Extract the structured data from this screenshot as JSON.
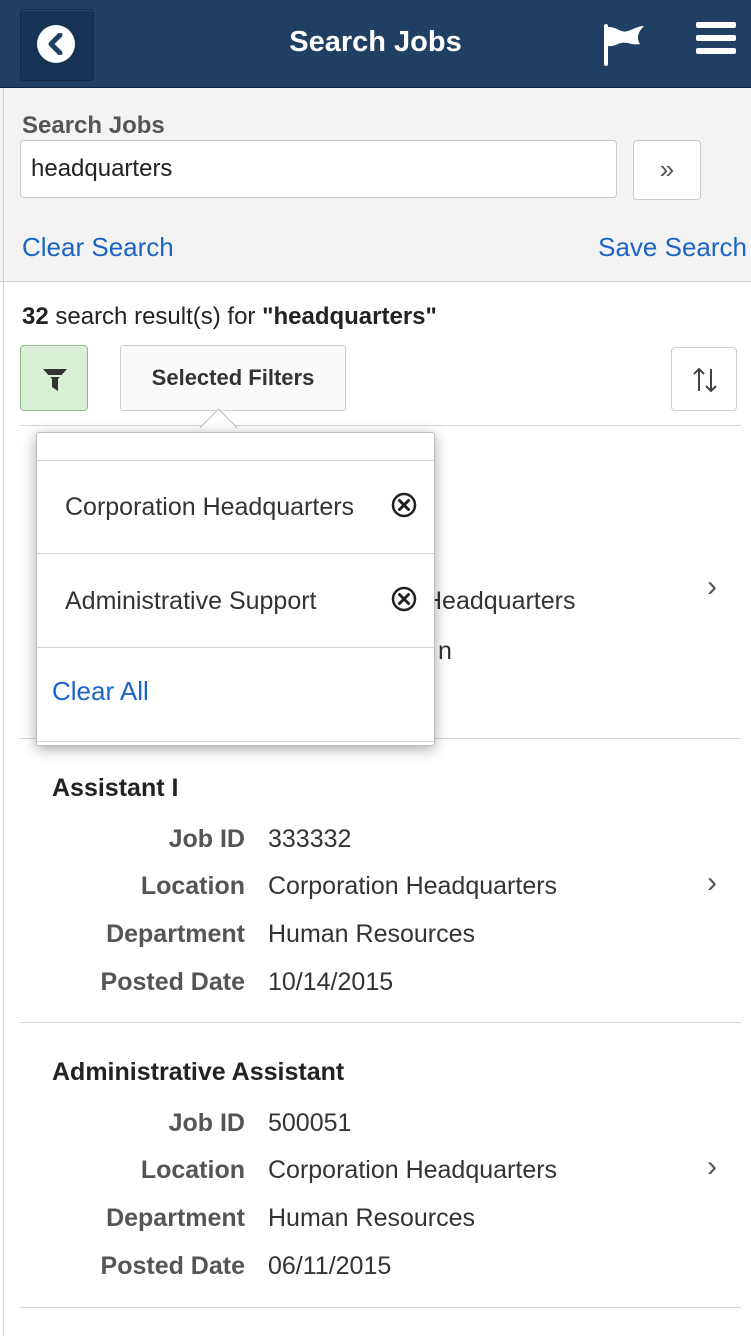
{
  "header": {
    "title": "Search Jobs"
  },
  "search": {
    "label": "Search Jobs",
    "value": "headquarters",
    "go_label": "»",
    "clear_label": "Clear Search",
    "save_label": "Save Search"
  },
  "results": {
    "count": "32",
    "text": " search result(s) for ",
    "query": "\"headquarters\""
  },
  "toolbar": {
    "selected_filters_label": "Selected Filters"
  },
  "popup": {
    "filters": [
      "Corporation Headquarters",
      "Administrative Support"
    ],
    "clear_all_label": "Clear All"
  },
  "field_labels": {
    "job_id": "Job ID",
    "location": "Location",
    "department": "Department",
    "posted_date": "Posted Date"
  },
  "jobs": [
    {
      "title": "",
      "location_partial": "Headquarters",
      "department_partial": "n"
    },
    {
      "title": "Assistant I",
      "job_id": "333332",
      "location": "Corporation Headquarters",
      "department": "Human Resources",
      "posted_date": "10/14/2015"
    },
    {
      "title": "Administrative Assistant",
      "job_id": "500051",
      "location": "Corporation Headquarters",
      "department": "Human Resources",
      "posted_date": "06/11/2015"
    }
  ],
  "icons": {
    "back": "chevron-left-icon",
    "flag": "flag-icon",
    "menu": "hamburger-menu-icon",
    "filter": "funnel-icon",
    "sort": "sort-arrows-icon",
    "remove": "close-circle-icon",
    "row": "chevron-right-icon"
  },
  "colors": {
    "header_bg": "#1f3f63",
    "link": "#1a64c8",
    "filter_active_bg": "#d9efd6"
  }
}
